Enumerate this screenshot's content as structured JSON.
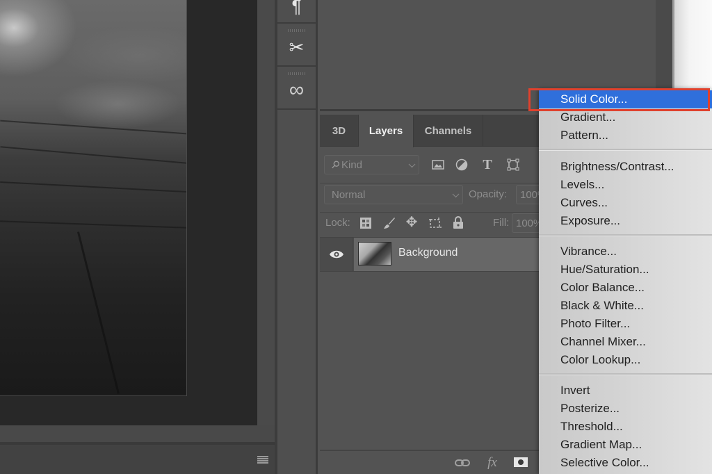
{
  "canvas": {
    "status_menu_icon": "hamburger-icon"
  },
  "icon_strip": {
    "items": [
      {
        "name": "paragraph-icon",
        "glyph": "¶"
      },
      {
        "name": "tools-icon",
        "glyph": "✂"
      },
      {
        "name": "creative-cloud-icon",
        "glyph": "∞"
      }
    ]
  },
  "layers_panel": {
    "tabs": [
      {
        "label": "3D",
        "active": false
      },
      {
        "label": "Layers",
        "active": true
      },
      {
        "label": "Channels",
        "active": false
      }
    ],
    "filter": {
      "search_glyph": "⚲",
      "kind_label": "Kind",
      "filter_icons": [
        "image-filter-icon",
        "adjustment-filter-icon",
        "type-filter-icon",
        "shape-filter-icon"
      ]
    },
    "blend_mode": "Normal",
    "opacity_label": "Opacity:",
    "opacity_value": "100%",
    "lock_label": "Lock:",
    "lock_icons": [
      "lock-transparent-pixels-icon",
      "lock-image-pixels-icon",
      "lock-position-icon",
      "lock-artboard-icon",
      "lock-all-icon"
    ],
    "fill_label": "Fill:",
    "fill_value": "100%",
    "layers": [
      {
        "name": "Background",
        "visible": true
      }
    ],
    "footer_icons": [
      "link-layers-icon",
      "fx-icon",
      "add-mask-icon"
    ],
    "fx_label": "fx"
  },
  "adjustment_menu": {
    "selected": "Solid Color...",
    "groups": [
      [
        "Solid Color...",
        "Gradient...",
        "Pattern..."
      ],
      [
        "Brightness/Contrast...",
        "Levels...",
        "Curves...",
        "Exposure..."
      ],
      [
        "Vibrance...",
        "Hue/Saturation...",
        "Color Balance...",
        "Black & White...",
        "Photo Filter...",
        "Channel Mixer...",
        "Color Lookup..."
      ],
      [
        "Invert",
        "Posterize...",
        "Threshold...",
        "Gradient Map...",
        "Selective Color..."
      ]
    ]
  },
  "colors": {
    "selection_blue": "#2f6fdb",
    "highlight_red": "#e0412d",
    "panel_gray": "#535353"
  }
}
